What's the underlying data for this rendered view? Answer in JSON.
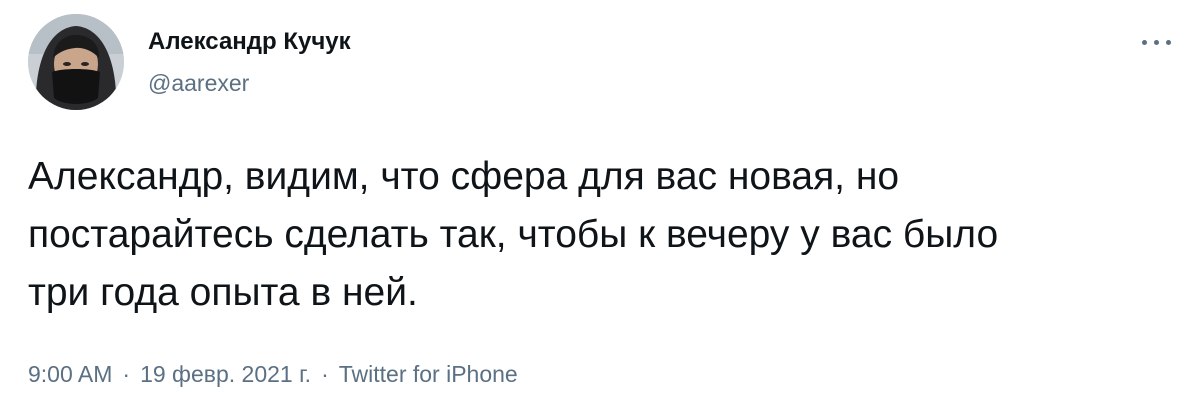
{
  "author": {
    "name": "Александр Кучук",
    "handle": "@aarexer"
  },
  "tweet": {
    "lines": [
      "Александр, видим, что сфера для вас новая, но",
      "постарайтесь сделать так, чтобы к вечеру у вас было",
      "три года опыта в ней."
    ]
  },
  "meta": {
    "time": "9:00 AM",
    "separator": "·",
    "date": "19 февр. 2021 г.",
    "source": "Twitter for iPhone"
  },
  "icons": {
    "more": "more-horizontal-icon"
  },
  "colors": {
    "text": "#0f1419",
    "secondary": "#5b7083",
    "background": "#ffffff"
  }
}
